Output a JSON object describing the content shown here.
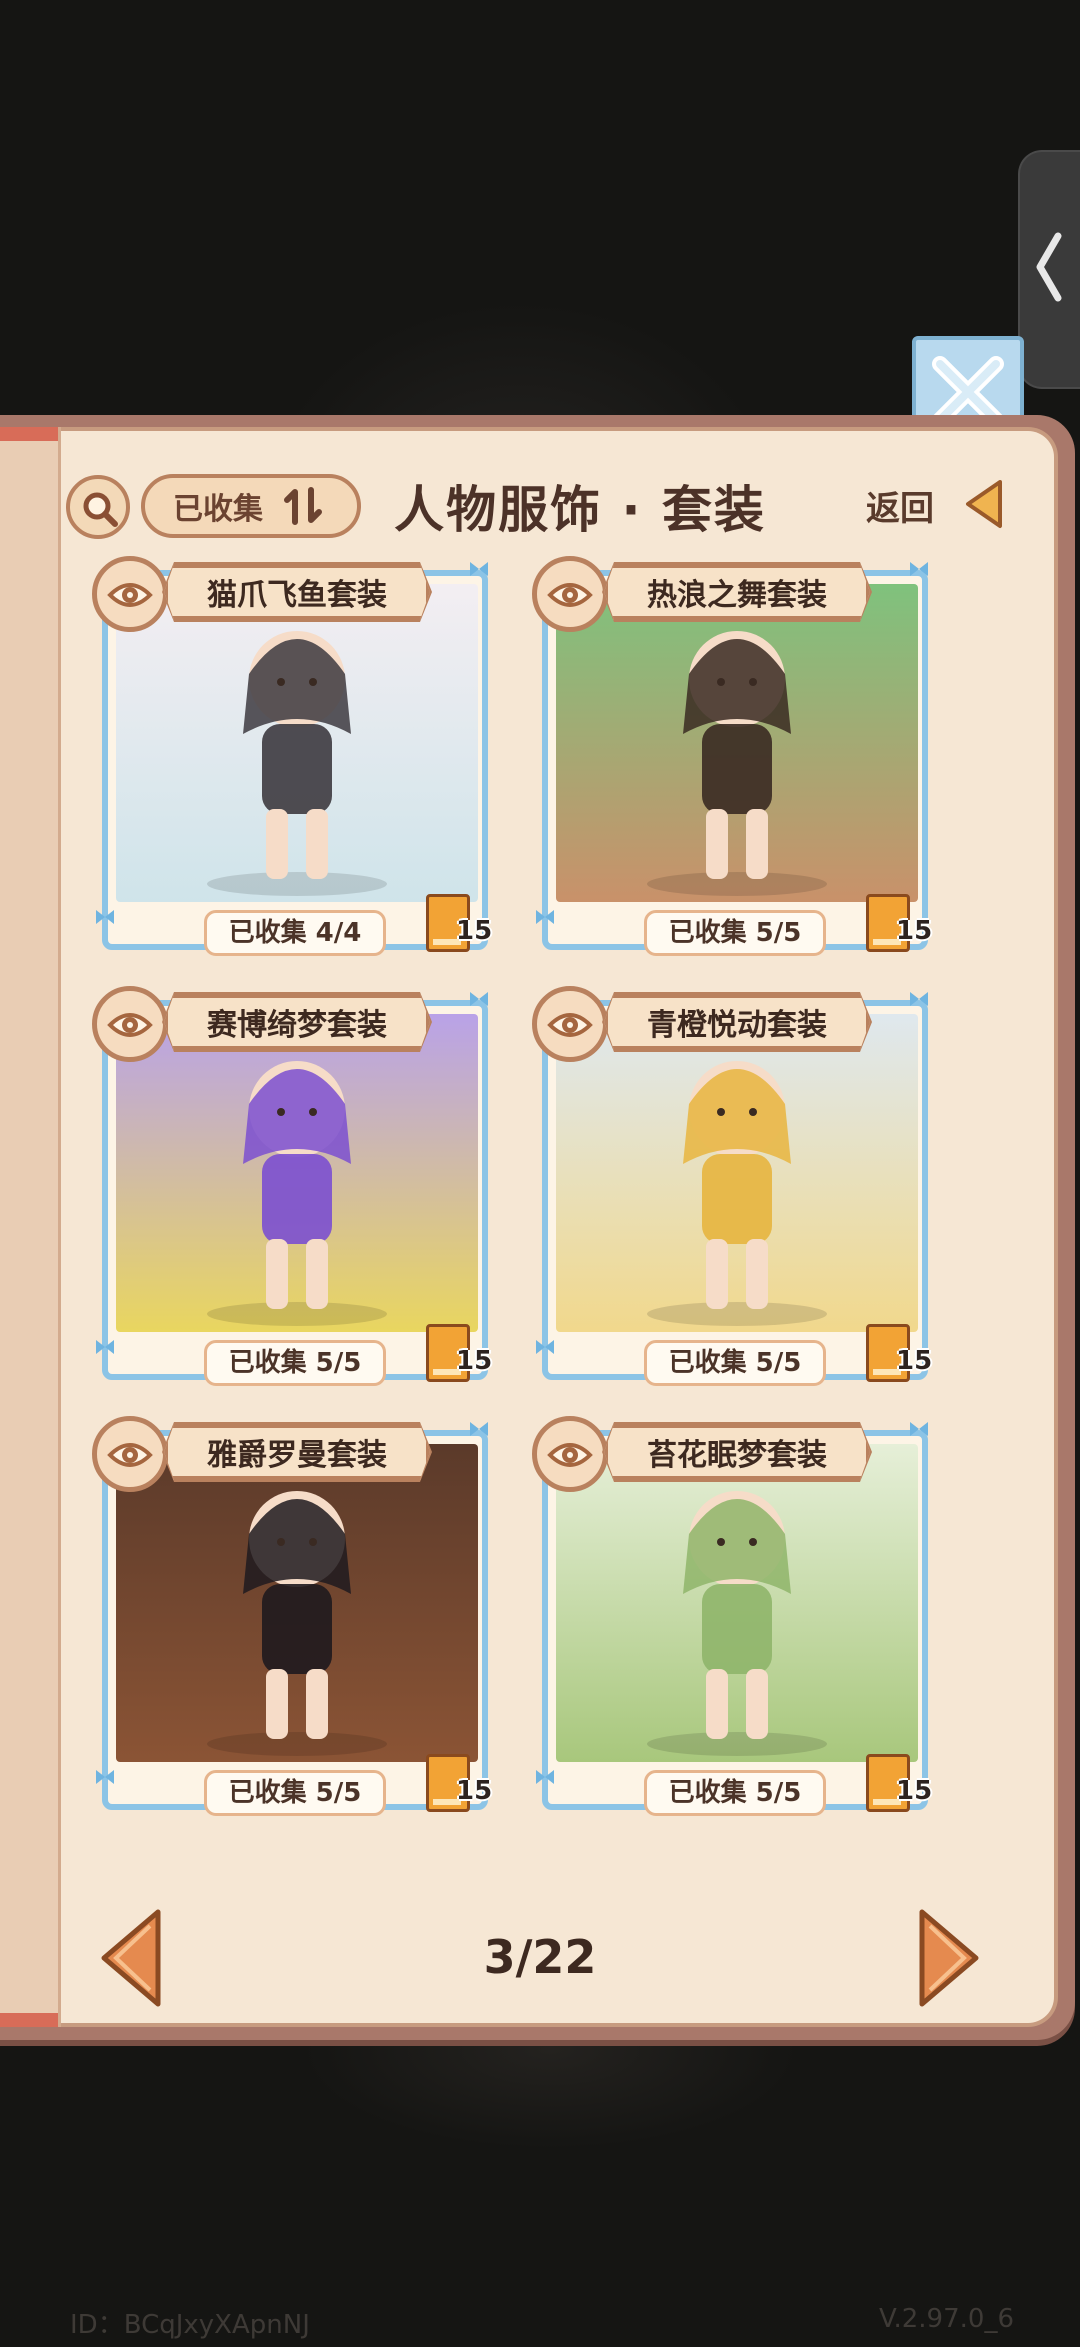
{
  "header": {
    "title": "人物服饰 · 套装",
    "filter_label": "已收集",
    "back_label": "返回"
  },
  "cards": [
    {
      "name": "猫爪飞鱼套装",
      "collected": "已收集 4/4",
      "points": "15",
      "art_top": "#f3eef2",
      "art_bottom": "#cfe4ea",
      "accent": "#3d3a3f"
    },
    {
      "name": "热浪之舞套装",
      "collected": "已收集 5/5",
      "points": "15",
      "art_top": "#7fc27d",
      "art_bottom": "#c9916a",
      "accent": "#3a2a22"
    },
    {
      "name": "赛博绮梦套装",
      "collected": "已收集 5/5",
      "points": "15",
      "art_top": "#b9a2e8",
      "art_bottom": "#e9d65f",
      "accent": "#7b4fd0"
    },
    {
      "name": "青橙悦动套装",
      "collected": "已收集 5/5",
      "points": "15",
      "art_top": "#dfe8ee",
      "art_bottom": "#f1d88c",
      "accent": "#e7b53f"
    },
    {
      "name": "雅爵罗曼套装",
      "collected": "已收集 5/5",
      "points": "15",
      "art_top": "#5b3a2a",
      "art_bottom": "#8b5435",
      "accent": "#1f1a1e"
    },
    {
      "name": "苔花眠梦套装",
      "collected": "已收集 5/5",
      "points": "15",
      "art_top": "#e6efd8",
      "art_bottom": "#a8c77c",
      "accent": "#8fb56a"
    }
  ],
  "pagination": {
    "page": "3/22"
  },
  "footer": {
    "id": "ID：BCqJxyXApnNJ",
    "version": "V.2.97.0_6"
  },
  "colors": {
    "page_bg": "#f6e7d4",
    "frame_blue": "#8cc4e6",
    "brown_border": "#b9815e",
    "arrow_orange": "#e58a4f"
  }
}
